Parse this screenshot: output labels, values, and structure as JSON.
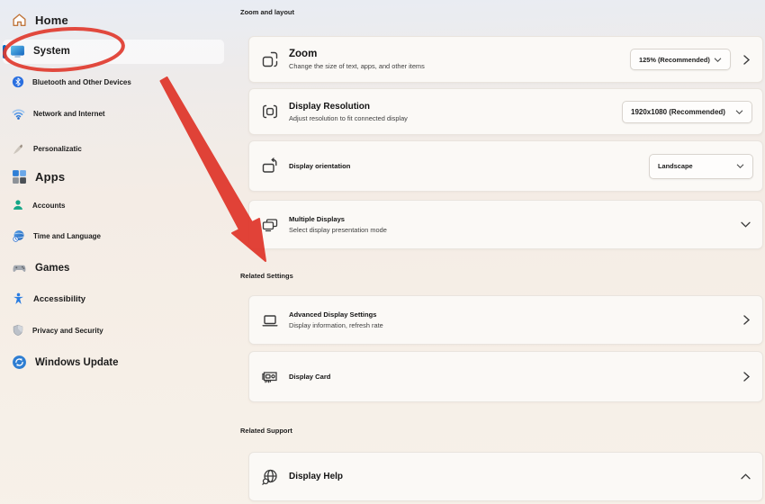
{
  "annotations": {
    "highlight_color": "#e0392e",
    "circled_item": "System",
    "arrow_points_to": "Related Settings"
  },
  "sidebar": {
    "items": [
      {
        "label": "Home"
      },
      {
        "label": "System",
        "selected": true
      },
      {
        "label": "Bluetooth and Other Devices"
      },
      {
        "label": "Network and Internet"
      },
      {
        "label": "Personalizatic"
      },
      {
        "label": "Apps"
      },
      {
        "label": "Accounts"
      },
      {
        "label": "Time and Language"
      },
      {
        "label": "Games"
      },
      {
        "label": "Accessibility"
      },
      {
        "label": "Privacy and Security"
      },
      {
        "label": "Windows Update"
      }
    ]
  },
  "main": {
    "section1_header": "Zoom and layout",
    "section2_header": "Related Settings",
    "section3_header": "Related Support",
    "cards": {
      "zoom": {
        "title": "Zoom",
        "subtitle": "Change the size of text, apps, and other items",
        "value": "125% (Recommended)"
      },
      "resolution": {
        "title": "Display Resolution",
        "subtitle": "Adjust resolution to fit connected display",
        "value": "1920x1080 (Recommended)"
      },
      "orientation": {
        "title": "Display orientation",
        "value": "Landscape"
      },
      "multiple_displays": {
        "title": "Multiple Displays",
        "subtitle": "Select display presentation mode"
      },
      "advanced": {
        "title": "Advanced Display Settings",
        "subtitle": "Display information, refresh rate"
      },
      "display_card": {
        "title": "Display Card"
      },
      "display_help": {
        "title": "Display Help"
      }
    }
  }
}
